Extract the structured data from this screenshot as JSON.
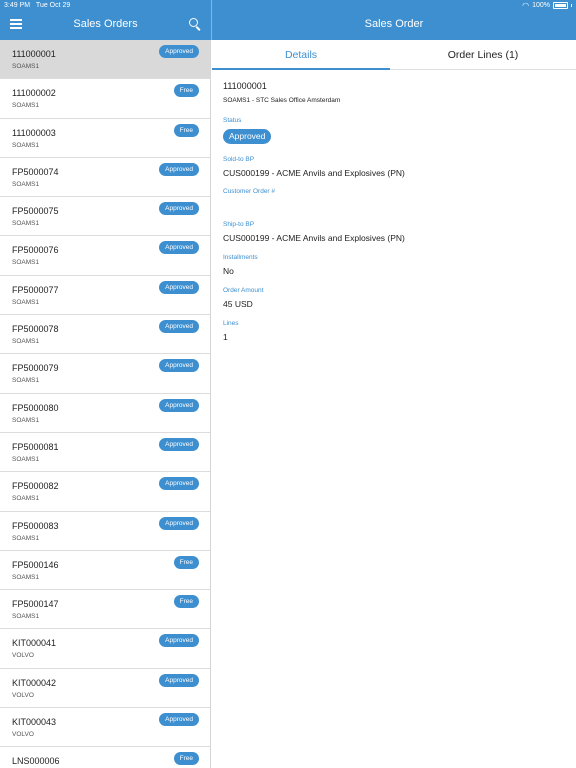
{
  "status_bar": {
    "time": "3:49 PM",
    "date": "Tue Oct 29",
    "battery": "100%",
    "wifi_icon": "wifi-icon"
  },
  "left_header": {
    "title": "Sales Orders",
    "menu_icon": "hamburger-menu-icon",
    "search_icon": "search-icon"
  },
  "right_header": {
    "title": "Sales Order"
  },
  "colors": {
    "accent": "#3d8fd0",
    "selected_row": "#d9d9d9"
  },
  "orders": [
    {
      "number": "111000001",
      "org": "SOAMS1",
      "status": "Approved"
    },
    {
      "number": "111000002",
      "org": "SOAMS1",
      "status": "Free"
    },
    {
      "number": "111000003",
      "org": "SOAMS1",
      "status": "Free"
    },
    {
      "number": "FP5000074",
      "org": "SOAMS1",
      "status": "Approved"
    },
    {
      "number": "FP5000075",
      "org": "SOAMS1",
      "status": "Approved"
    },
    {
      "number": "FP5000076",
      "org": "SOAMS1",
      "status": "Approved"
    },
    {
      "number": "FP5000077",
      "org": "SOAMS1",
      "status": "Approved"
    },
    {
      "number": "FP5000078",
      "org": "SOAMS1",
      "status": "Approved"
    },
    {
      "number": "FP5000079",
      "org": "SOAMS1",
      "status": "Approved"
    },
    {
      "number": "FP5000080",
      "org": "SOAMS1",
      "status": "Approved"
    },
    {
      "number": "FP5000081",
      "org": "SOAMS1",
      "status": "Approved"
    },
    {
      "number": "FP5000082",
      "org": "SOAMS1",
      "status": "Approved"
    },
    {
      "number": "FP5000083",
      "org": "SOAMS1",
      "status": "Approved"
    },
    {
      "number": "FP5000146",
      "org": "SOAMS1",
      "status": "Free"
    },
    {
      "number": "FP5000147",
      "org": "SOAMS1",
      "status": "Free"
    },
    {
      "number": "KIT000041",
      "org": "VOLVO",
      "status": "Approved"
    },
    {
      "number": "KIT000042",
      "org": "VOLVO",
      "status": "Approved"
    },
    {
      "number": "KIT000043",
      "org": "VOLVO",
      "status": "Approved"
    },
    {
      "number": "LNS000006",
      "org": "",
      "status": "Free"
    }
  ],
  "detail": {
    "tabs": {
      "details": "Details",
      "order_lines": "Order Lines (1)"
    },
    "order_number": "111000001",
    "office": "SOAMS1 - STC Sales Office Amsterdam",
    "status_label": "Status",
    "status_value": "Approved",
    "sold_to_label": "Sold-to BP",
    "sold_to_value": "CUS000199 - ACME Anvils and Explosives (PN)",
    "customer_order_label": "Customer Order #",
    "ship_to_label": "Ship-to BP",
    "ship_to_value": "CUS000199 - ACME Anvils and Explosives (PN)",
    "installments_label": "Installments",
    "installments_value": "No",
    "order_amount_label": "Order Amount",
    "order_amount_value": "45 USD",
    "lines_label": "Lines",
    "lines_value": "1"
  }
}
